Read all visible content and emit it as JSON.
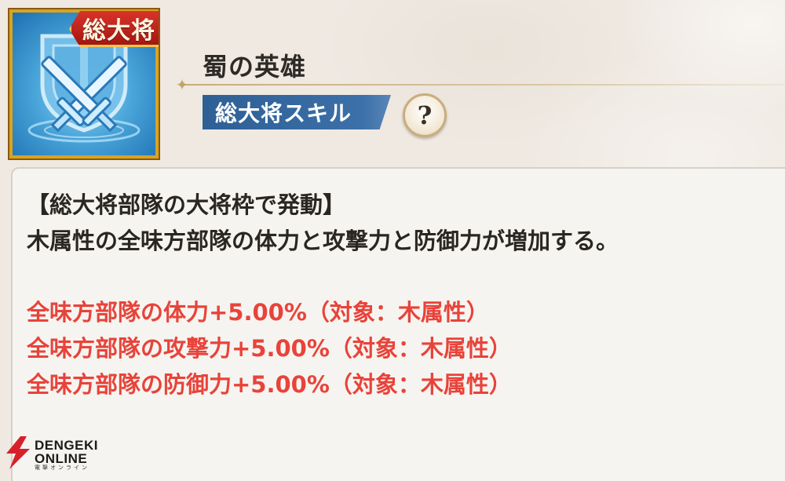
{
  "skill": {
    "rank_badge": "総大将",
    "name": "蜀の英雄",
    "type_tag": "総大将スキル",
    "help_label": "?"
  },
  "description": {
    "condition": "【総大将部隊の大将枠で発動】",
    "summary": "木属性の全味方部隊の体力と攻撃力と防御力が増加する。",
    "effects": [
      "全味方部隊の体力+5.00%（対象：木属性）",
      "全味方部隊の攻撃力+5.00%（対象：木属性）",
      "全味方部隊の防御力+5.00%（対象：木属性）"
    ]
  },
  "watermark": {
    "line1": "DENGEKI",
    "line2": "ONLINE",
    "line3": "電撃オンライン"
  },
  "colors": {
    "effect_text": "#e8433a",
    "tag_blue": "#2e5f95",
    "frame_gold": "#d9a321",
    "ribbon_red": "#c8261e"
  },
  "icons": {
    "skill_icon": "crossed-swords-shield-icon",
    "help_icon": "question-mark-icon",
    "watermark_logo": "lightning-bolt-icon"
  }
}
